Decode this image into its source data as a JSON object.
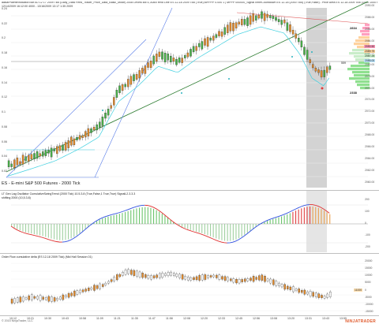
{
  "header": {
    "line1": "aaBarPaletteIndicator.Bar.SD 12 17 2009 Tick (Daily_Data Feed_Trader_Price_Data_Basic_Mode) 2008 Levels Bill 5, AutoTrend Line ES 12-18 2009 Tick (True),MPPPP 0.000 1 | MPPP 000000_SignalTimerCountdown ES 12-18 (2000 Tick) (True,False) - Price Area ES 12-18 2009 Tick (1000 1000 Falser Falser Ture)",
    "line2": "12/14/2009 16:12:00 4000 - 13/16/2009 13:17 1:35 2009"
  },
  "main_panel": {
    "title": "ES - E-mini S&P 500 Futures - 2000 Tick",
    "left_axis": [
      "0.24",
      "0.22",
      "0.2",
      "0.18",
      "0.16",
      "0.14",
      "0.12",
      "0.1",
      "0.08",
      "0.06",
      "0.04",
      "0.02"
    ],
    "right_axis": [
      "2090.00",
      "2088.00",
      "2086.00",
      "2084.00",
      "2082.00",
      "2080.00",
      "2078.00",
      "2076.00",
      "2074.00",
      "2072.00",
      "2070.00",
      "2068.00",
      "2066.00",
      "2064.00",
      "2062.00",
      "2060.00"
    ],
    "volume_profile": {
      "top_value": "2834",
      "mid_value": "559",
      "bottom_value": "2338"
    },
    "price_tags": [
      {
        "label": "2090.50",
        "color": "#ff99bb"
      },
      {
        "label": "2089.75",
        "color": "#ffd6a0"
      },
      {
        "label": "2087.25",
        "color": "#c9f0c9"
      },
      {
        "label": "2085.00",
        "color": "#bfe7ff"
      }
    ]
  },
  "oscillator_panel": {
    "title": "LT Gen Lag Oscillator CumulativeSwingTrend (2000 Tick) 10.5.3.8 (True,False,1 True,True) SignalL2.3.3.3",
    "subtitle": "shifting 2000 (10,5.3.8)",
    "right_axis": [
      "200",
      "100",
      "0",
      "-100",
      "-200"
    ]
  },
  "delta_panel": {
    "title": "Order Flow cumulative delta (ES 12-18 2009 Tick) (Mid Hall Session 01)",
    "right_axis": [
      "20000",
      "15000",
      "10000",
      "5000",
      "0",
      "-5000",
      "-10000",
      "-15000"
    ],
    "last_value": "11000"
  },
  "x_axis": [
    "10:12",
    "10:21",
    "10:30",
    "10:43",
    "10:58",
    "11:09",
    "11:21",
    "11:35",
    "11:47",
    "11:58",
    "12:08",
    "12:20",
    "12:33",
    "12:45",
    "12:56",
    "13:08",
    "13:20",
    "13:31",
    "13:43",
    "13:55"
  ],
  "footer": {
    "copyright": "© 2015 NinjaTrader, LLC",
    "watermark": "NINJATRADER"
  },
  "colors": {
    "bull_candle": "#48b048",
    "bear_candle": "#e08a2c",
    "ema_line": "#40d0e0",
    "trend_line": "#2e7d32",
    "blue_trend": "#5a7ee8",
    "red_trend": "#e05a5a",
    "shade": "#d0d0d0"
  }
}
